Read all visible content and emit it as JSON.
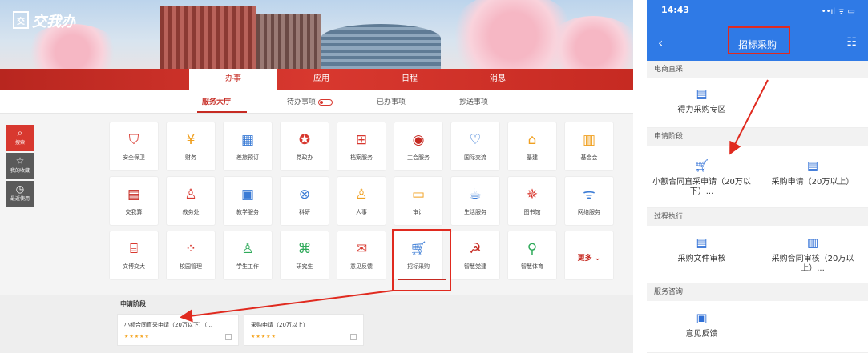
{
  "portal": {
    "logo_text": "交我办",
    "main_nav": [
      "办事",
      "应用",
      "日程",
      "消息"
    ],
    "sub_nav": [
      "服务大厅",
      "待办事项",
      "已办事项",
      "抄送事项"
    ],
    "sidebar": [
      {
        "icon": "search-icon",
        "label": "搜索"
      },
      {
        "icon": "star-icon",
        "label": "我的收藏"
      },
      {
        "icon": "clock-icon",
        "label": "最近使用"
      }
    ],
    "tiles": [
      [
        "安全保卫",
        "财务",
        "差旅预订",
        "党政办",
        "档案服务",
        "工会服务",
        "国际交流",
        "基建",
        "基金会"
      ],
      [
        "交我算",
        "教务处",
        "教学服务",
        "科研",
        "人事",
        "审计",
        "生活服务",
        "图书馆",
        "网络服务"
      ],
      [
        "文博交大",
        "校园管理",
        "学生工作",
        "研究生",
        "意见反馈",
        "招标采购",
        "智慧党建",
        "智慧体育",
        "更多"
      ]
    ],
    "section_title": "申请阶段",
    "cards": [
      {
        "label": "小额合同直采申请（20万以下）（...",
        "stars": "★★★★★"
      },
      {
        "label": "采购申请（20万以上）",
        "stars": "★★★★★"
      }
    ]
  },
  "phone": {
    "time": "14:43",
    "status_icons": "••ıl ᯤ ▭",
    "back": "‹",
    "title": "招标采购",
    "sections": [
      {
        "title": "电商直采",
        "items": [
          "得力采购专区"
        ]
      },
      {
        "title": "申请阶段",
        "items": [
          "小额合同直采申请（20万以下）...",
          "采购申请（20万以上）"
        ]
      },
      {
        "title": "过程执行",
        "items": [
          "采购文件审核",
          "采购合同审核（20万以上）..."
        ]
      },
      {
        "title": "服务咨询",
        "items": [
          "意见反馈"
        ]
      }
    ]
  },
  "colors": {
    "brand_red": "#c62a22",
    "phone_blue": "#2f7ae6",
    "annotation_red": "#e02a1f"
  }
}
